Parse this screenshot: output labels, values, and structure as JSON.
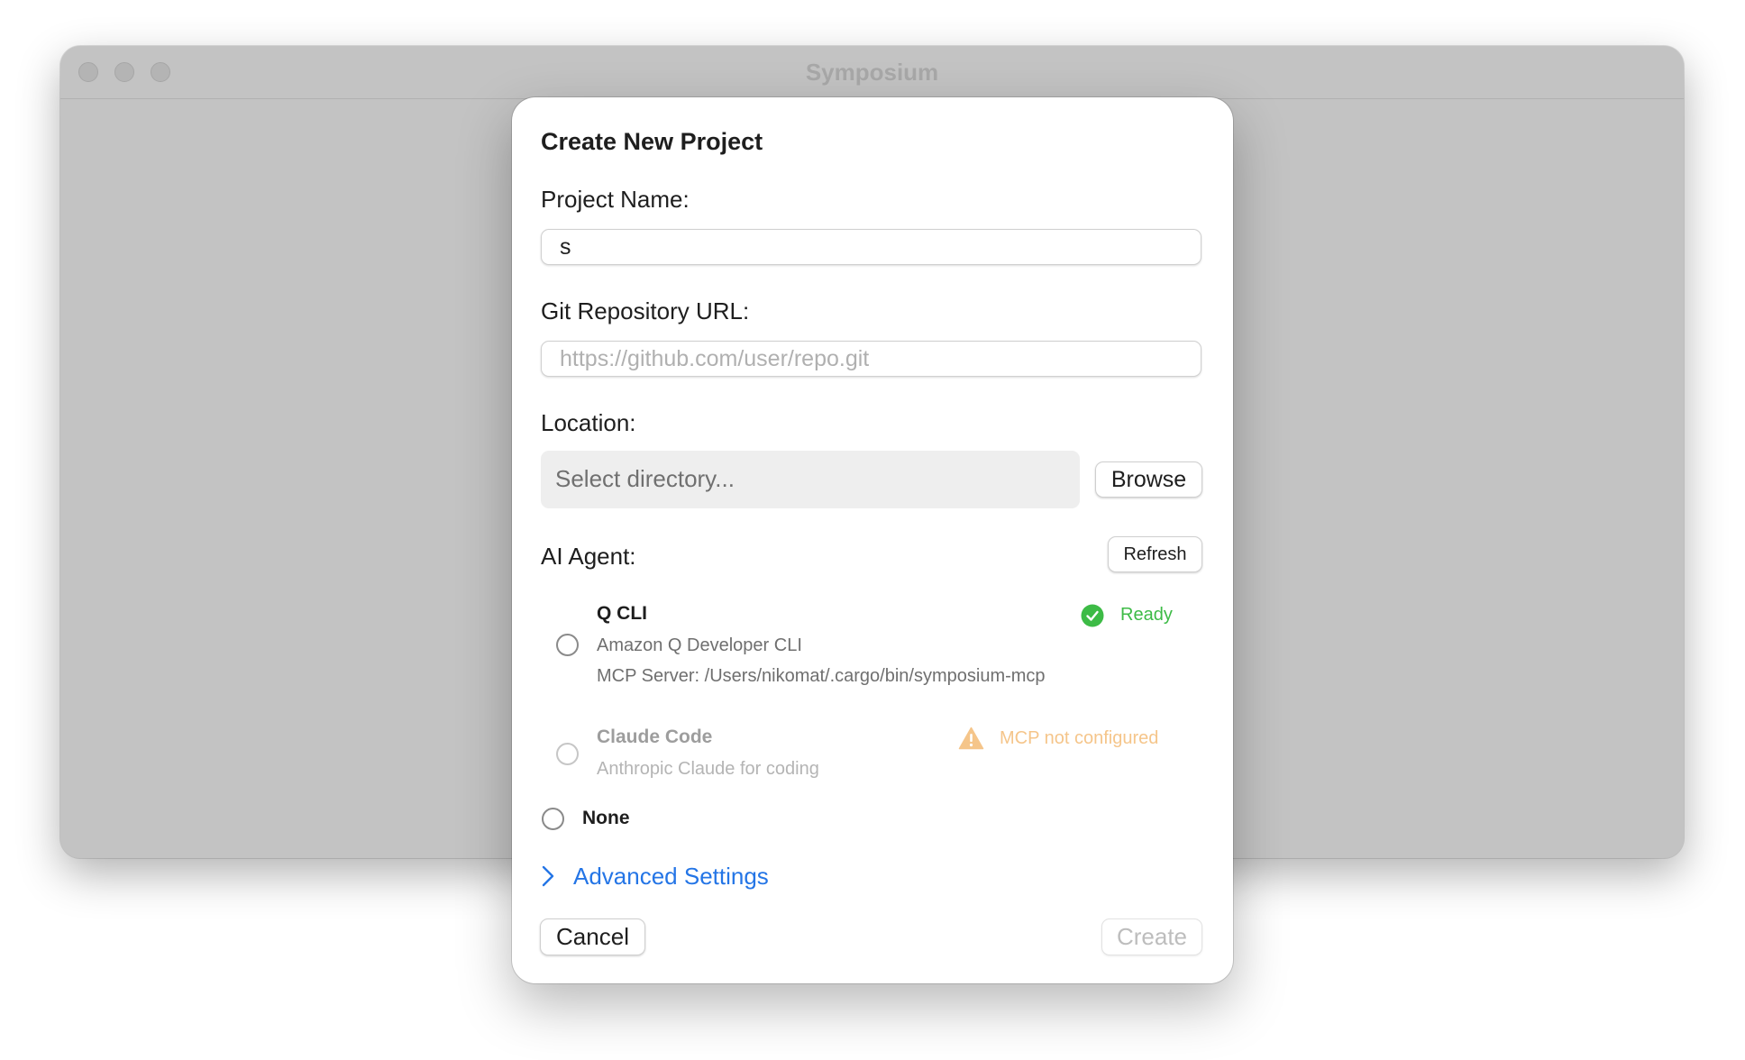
{
  "window": {
    "title": "Symposium"
  },
  "dialog": {
    "title": "Create New Project",
    "project_name": {
      "label": "Project Name:",
      "value": "s"
    },
    "git_url": {
      "label": "Git Repository URL:",
      "value": "",
      "placeholder": "https://github.com/user/repo.git"
    },
    "location": {
      "label": "Location:",
      "placeholder": "Select directory...",
      "browse_label": "Browse"
    },
    "ai_agent": {
      "label": "AI Agent:",
      "refresh_label": "Refresh",
      "agents": [
        {
          "name": "Q CLI",
          "description": "Amazon Q Developer CLI",
          "mcp_server": "MCP Server: /Users/nikomat/.cargo/bin/symposium-mcp",
          "status": "Ready",
          "status_icon": "checkmark-circle-icon",
          "status_color": "#3dbb46",
          "enabled": true,
          "selected": false
        },
        {
          "name": "Claude Code",
          "description": "Anthropic Claude for coding",
          "status": "MCP not configured",
          "status_icon": "warning-triangle-icon",
          "status_color": "#f5c58a",
          "enabled": false,
          "selected": false
        }
      ],
      "none_label": "None"
    },
    "advanced_label": "Advanced Settings",
    "cancel_label": "Cancel",
    "create_label": "Create"
  },
  "colors": {
    "accent": "#2475e6",
    "ready": "#3dbb46",
    "warning": "#f5c58a",
    "window_bg": "#c3c3c3"
  }
}
